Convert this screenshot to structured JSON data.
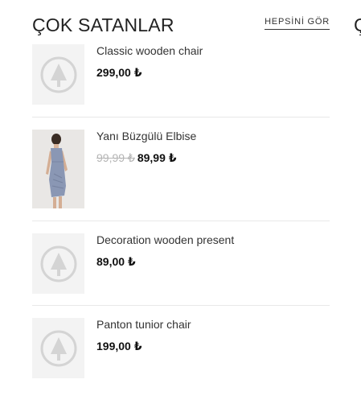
{
  "widget": {
    "title": "ÇOK SATANLAR",
    "see_all_label": "HEPSİNİ GÖR",
    "next_widget_title_partial": "Ç"
  },
  "products": [
    {
      "name": "Classic wooden chair",
      "price": "299,00 ₺",
      "image": "placeholder-tree-icon"
    },
    {
      "name": "Yanı Büzgülü Elbise",
      "old_price": "99,99 ₺",
      "price": "89,99 ₺",
      "image": "dress-photo"
    },
    {
      "name": "Decoration wooden present",
      "price": "89,00 ₺",
      "image": "placeholder-tree-icon"
    },
    {
      "name": "Panton tunior chair",
      "price": "199,00 ₺",
      "image": "placeholder-tree-icon"
    }
  ],
  "colors": {
    "text": "#222222",
    "old_price": "#b5b5b5",
    "divider": "#e8e8e8",
    "placeholder_bg": "#f3f3f3",
    "dress": "#8a97b4"
  }
}
